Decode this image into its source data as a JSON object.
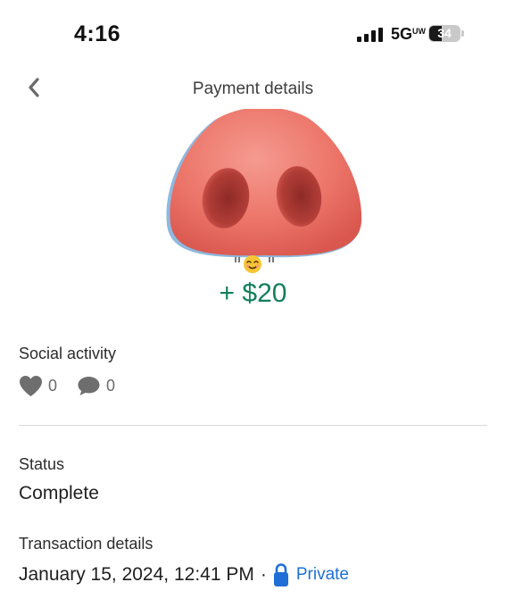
{
  "status_bar": {
    "time": "4:16",
    "network": "5G",
    "network_superscript": "UW",
    "battery": "34"
  },
  "header": {
    "title": "Payment details",
    "back_icon": "chevron-left-icon"
  },
  "payment": {
    "image": "pig-nose",
    "amount": "+ $20"
  },
  "social": {
    "label": "Social activity",
    "likes": "0",
    "comments": "0"
  },
  "status": {
    "label": "Status",
    "value": "Complete"
  },
  "transaction": {
    "label": "Transaction details",
    "date": "January 15, 2024, 12:41 PM",
    "separator": "·",
    "privacy": "Private"
  },
  "colors": {
    "amount_green": "#137f5c",
    "link_blue": "#1f6fd6",
    "icon_gray": "#6e6e6e"
  }
}
